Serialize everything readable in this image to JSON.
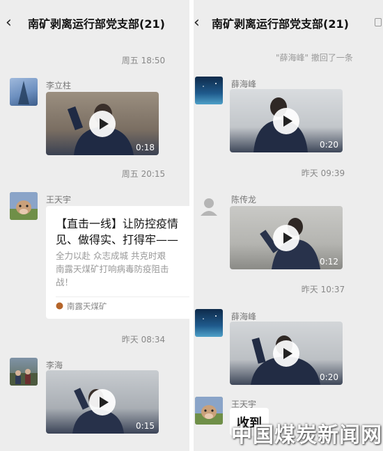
{
  "left": {
    "header": {
      "title": "南矿剥离运行部党支部(21)",
      "back_icon": "‹"
    },
    "messages": [
      {
        "type": "time",
        "text": "周五 18:50"
      },
      {
        "type": "video",
        "sender": "李立柱",
        "duration": "0:18"
      },
      {
        "type": "time",
        "text": "周五 20:15"
      },
      {
        "type": "link",
        "sender": "王天宇",
        "title": "【直击一线】让防控疫情\n见、做得实、打得牢——",
        "desc": "全力以赴 众志成城 共克时艰\n南露天煤矿打响病毒防疫阻击\n战！",
        "source": "南露天煤矿"
      },
      {
        "type": "time",
        "text": "昨天 08:34"
      },
      {
        "type": "video",
        "sender": "李海",
        "duration": "0:15"
      }
    ]
  },
  "right": {
    "header": {
      "title": "南矿剥离运行部党支部(21)",
      "back_icon": "‹"
    },
    "recall_notice": "\"薛海峰\" 撤回了一条",
    "messages": [
      {
        "type": "video",
        "sender": "薛海峰",
        "duration": "0:20"
      },
      {
        "type": "time",
        "text": "昨天 09:39"
      },
      {
        "type": "video",
        "sender": "陈传龙",
        "duration": "0:12"
      },
      {
        "type": "time",
        "text": "昨天 10:37"
      },
      {
        "type": "video",
        "sender": "薛海峰",
        "duration": "0:20"
      },
      {
        "type": "text",
        "sender": "王天宇",
        "text": "收到"
      }
    ]
  },
  "watermark": "中国煤炭新闻网",
  "colors": {
    "background": "#ededed",
    "bubble": "#ffffff",
    "time_text": "#888888"
  }
}
